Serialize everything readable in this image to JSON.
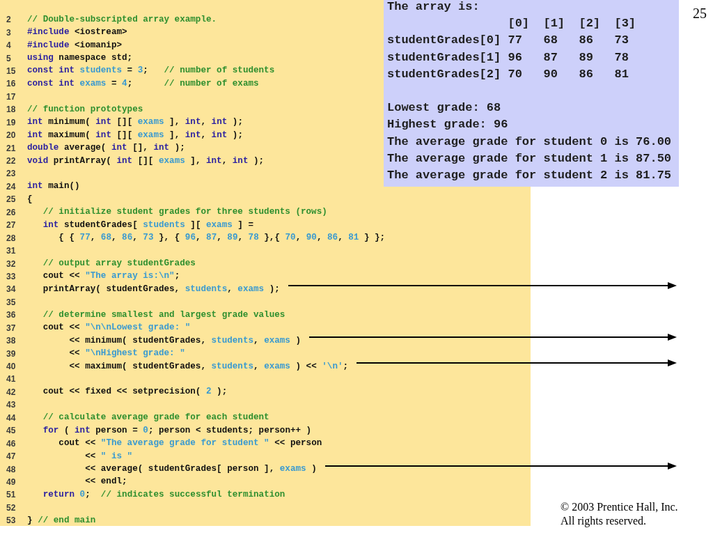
{
  "slide": {
    "number": "25"
  },
  "code": {
    "lines": [
      {
        "number": "2",
        "arrow": false,
        "tokens": [
          {
            "kind": "comment",
            "text": "// Double-subscripted array example."
          }
        ]
      },
      {
        "number": "3",
        "arrow": false,
        "tokens": [
          {
            "kind": "keyword",
            "text": "#include"
          },
          {
            "kind": "plain",
            "text": " <iostream>"
          }
        ]
      },
      {
        "number": "4",
        "arrow": false,
        "tokens": [
          {
            "kind": "keyword",
            "text": "#include"
          },
          {
            "kind": "plain",
            "text": " <iomanip>"
          }
        ]
      },
      {
        "number": "5",
        "arrow": false,
        "tokens": [
          {
            "kind": "keyword",
            "text": "using"
          },
          {
            "kind": "plain",
            "text": " namespace std;"
          }
        ]
      },
      {
        "number": "15",
        "arrow": false,
        "tokens": [
          {
            "kind": "keyword",
            "text": "const int "
          },
          {
            "kind": "literal",
            "text": "students"
          },
          {
            "kind": "plain",
            "text": " = "
          },
          {
            "kind": "literal",
            "text": "3"
          },
          {
            "kind": "plain",
            "text": ";   "
          },
          {
            "kind": "comment",
            "text": "// number of students"
          }
        ]
      },
      {
        "number": "16",
        "arrow": false,
        "tokens": [
          {
            "kind": "keyword",
            "text": "const int "
          },
          {
            "kind": "literal",
            "text": "exams"
          },
          {
            "kind": "plain",
            "text": " = "
          },
          {
            "kind": "literal",
            "text": "4"
          },
          {
            "kind": "plain",
            "text": ";      "
          },
          {
            "kind": "comment",
            "text": "// number of exams"
          }
        ]
      },
      {
        "number": "17",
        "arrow": false
      },
      {
        "number": "18",
        "arrow": false,
        "tokens": [
          {
            "kind": "comment",
            "text": "// function prototypes"
          }
        ]
      },
      {
        "number": "19",
        "arrow": false,
        "tokens": [
          {
            "kind": "keyword",
            "text": "int"
          },
          {
            "kind": "plain",
            "text": " minimum( "
          },
          {
            "kind": "keyword",
            "text": "int"
          },
          {
            "kind": "plain",
            "text": " [][ "
          },
          {
            "kind": "literal",
            "text": "exams"
          },
          {
            "kind": "plain",
            "text": " ], "
          },
          {
            "kind": "keyword",
            "text": "int"
          },
          {
            "kind": "plain",
            "text": ", "
          },
          {
            "kind": "keyword",
            "text": "int"
          },
          {
            "kind": "plain",
            "text": " );"
          }
        ]
      },
      {
        "number": "20",
        "arrow": false,
        "tokens": [
          {
            "kind": "keyword",
            "text": "int"
          },
          {
            "kind": "plain",
            "text": " maximum( "
          },
          {
            "kind": "keyword",
            "text": "int"
          },
          {
            "kind": "plain",
            "text": " [][ "
          },
          {
            "kind": "literal",
            "text": "exams"
          },
          {
            "kind": "plain",
            "text": " ], "
          },
          {
            "kind": "keyword",
            "text": "int"
          },
          {
            "kind": "plain",
            "text": ", "
          },
          {
            "kind": "keyword",
            "text": "int"
          },
          {
            "kind": "plain",
            "text": " );"
          }
        ]
      },
      {
        "number": "21",
        "arrow": false,
        "tokens": [
          {
            "kind": "keyword",
            "text": "double"
          },
          {
            "kind": "plain",
            "text": " average( "
          },
          {
            "kind": "keyword",
            "text": "int"
          },
          {
            "kind": "plain",
            "text": " [], "
          },
          {
            "kind": "keyword",
            "text": "int"
          },
          {
            "kind": "plain",
            "text": " );"
          }
        ]
      },
      {
        "number": "22",
        "arrow": false,
        "tokens": [
          {
            "kind": "keyword",
            "text": "void"
          },
          {
            "kind": "plain",
            "text": " printArray( "
          },
          {
            "kind": "keyword",
            "text": "int"
          },
          {
            "kind": "plain",
            "text": " [][ "
          },
          {
            "kind": "literal",
            "text": "exams"
          },
          {
            "kind": "plain",
            "text": " ], "
          },
          {
            "kind": "keyword",
            "text": "int"
          },
          {
            "kind": "plain",
            "text": ", "
          },
          {
            "kind": "keyword",
            "text": "int"
          },
          {
            "kind": "plain",
            "text": " );"
          }
        ]
      },
      {
        "number": "23",
        "arrow": false
      },
      {
        "number": "24",
        "arrow": false,
        "tokens": [
          {
            "kind": "keyword",
            "text": "int"
          },
          {
            "kind": "plain",
            "text": " main()"
          }
        ]
      },
      {
        "number": "25",
        "arrow": false,
        "tokens": [
          {
            "kind": "plain",
            "text": "{"
          }
        ]
      },
      {
        "number": "26",
        "arrow": false,
        "tokens": [
          {
            "kind": "comment",
            "text": "   // initialize student grades for three students (rows)"
          }
        ]
      },
      {
        "number": "27",
        "arrow": false,
        "tokens": [
          {
            "kind": "keyword",
            "text": "   int"
          },
          {
            "kind": "plain",
            "text": " studentGrades[ "
          },
          {
            "kind": "literal",
            "text": "students"
          },
          {
            "kind": "plain",
            "text": " ][ "
          },
          {
            "kind": "literal",
            "text": "exams"
          },
          {
            "kind": "plain",
            "text": " ] ="
          }
        ]
      },
      {
        "number": "28",
        "arrow": false,
        "tokens": [
          {
            "kind": "plain",
            "text": "      { { "
          },
          {
            "kind": "literal",
            "text": "77"
          },
          {
            "kind": "plain",
            "text": ", "
          },
          {
            "kind": "literal",
            "text": "68"
          },
          {
            "kind": "plain",
            "text": ", "
          },
          {
            "kind": "literal",
            "text": "86"
          },
          {
            "kind": "plain",
            "text": ", "
          },
          {
            "kind": "literal",
            "text": "73"
          },
          {
            "kind": "plain",
            "text": " }, { "
          },
          {
            "kind": "literal",
            "text": "96"
          },
          {
            "kind": "plain",
            "text": ", "
          },
          {
            "kind": "literal",
            "text": "87"
          },
          {
            "kind": "plain",
            "text": ", "
          },
          {
            "kind": "literal",
            "text": "89"
          },
          {
            "kind": "plain",
            "text": ", "
          },
          {
            "kind": "literal",
            "text": "78"
          },
          {
            "kind": "plain",
            "text": " },{ "
          },
          {
            "kind": "literal",
            "text": "70"
          },
          {
            "kind": "plain",
            "text": ", "
          },
          {
            "kind": "literal",
            "text": "90"
          },
          {
            "kind": "plain",
            "text": ", "
          },
          {
            "kind": "literal",
            "text": "86"
          },
          {
            "kind": "plain",
            "text": ", "
          },
          {
            "kind": "literal",
            "text": "81"
          },
          {
            "kind": "plain",
            "text": " } };"
          }
        ]
      },
      {
        "number": "31",
        "arrow": false
      },
      {
        "number": "32",
        "arrow": false,
        "tokens": [
          {
            "kind": "comment",
            "text": "   // output array studentGrades"
          }
        ]
      },
      {
        "number": "33",
        "arrow": false,
        "tokens": [
          {
            "kind": "plain",
            "text": "   cout << "
          },
          {
            "kind": "literal",
            "text": "\"The array is:\\n\""
          },
          {
            "kind": "plain",
            "text": ";"
          }
        ]
      },
      {
        "number": "34",
        "arrow": true,
        "tokens": [
          {
            "kind": "plain",
            "text": "   printArray( studentGrades, "
          },
          {
            "kind": "literal",
            "text": "students"
          },
          {
            "kind": "plain",
            "text": ", "
          },
          {
            "kind": "literal",
            "text": "exams"
          },
          {
            "kind": "plain",
            "text": " );"
          }
        ]
      },
      {
        "number": "35",
        "arrow": false
      },
      {
        "number": "36",
        "arrow": false,
        "tokens": [
          {
            "kind": "comment",
            "text": "   // determine smallest and largest grade values"
          }
        ]
      },
      {
        "number": "37",
        "arrow": false,
        "tokens": [
          {
            "kind": "plain",
            "text": "   cout << "
          },
          {
            "kind": "literal",
            "text": "\"\\n\\nLowest grade: \""
          }
        ]
      },
      {
        "number": "38",
        "arrow": true,
        "tokens": [
          {
            "kind": "plain",
            "text": "        << minimum( studentGrades, "
          },
          {
            "kind": "literal",
            "text": "students"
          },
          {
            "kind": "plain",
            "text": ", "
          },
          {
            "kind": "literal",
            "text": "exams"
          },
          {
            "kind": "plain",
            "text": " )"
          }
        ]
      },
      {
        "number": "39",
        "arrow": false,
        "tokens": [
          {
            "kind": "plain",
            "text": "        << "
          },
          {
            "kind": "literal",
            "text": "\"\\nHighest grade: \""
          }
        ]
      },
      {
        "number": "40",
        "arrow": true,
        "tokens": [
          {
            "kind": "plain",
            "text": "        << maximum( studentGrades, "
          },
          {
            "kind": "literal",
            "text": "students"
          },
          {
            "kind": "plain",
            "text": ", "
          },
          {
            "kind": "literal",
            "text": "exams"
          },
          {
            "kind": "plain",
            "text": " ) << "
          },
          {
            "kind": "literal",
            "text": "'\\n'"
          },
          {
            "kind": "plain",
            "text": ";"
          }
        ]
      },
      {
        "number": "41",
        "arrow": false
      },
      {
        "number": "42",
        "arrow": false,
        "tokens": [
          {
            "kind": "plain",
            "text": "   cout << fixed << setprecision( "
          },
          {
            "kind": "literal",
            "text": "2"
          },
          {
            "kind": "plain",
            "text": " );"
          }
        ]
      },
      {
        "number": "43",
        "arrow": false
      },
      {
        "number": "44",
        "arrow": false,
        "tokens": [
          {
            "kind": "comment",
            "text": "   // calculate average grade for each student"
          }
        ]
      },
      {
        "number": "45",
        "arrow": false,
        "tokens": [
          {
            "kind": "keyword",
            "text": "   for"
          },
          {
            "kind": "plain",
            "text": " ( "
          },
          {
            "kind": "keyword",
            "text": "int"
          },
          {
            "kind": "plain",
            "text": " person = "
          },
          {
            "kind": "literal",
            "text": "0"
          },
          {
            "kind": "plain",
            "text": "; person < students; person++ )"
          }
        ]
      },
      {
        "number": "46",
        "arrow": false,
        "tokens": [
          {
            "kind": "plain",
            "text": "      cout << "
          },
          {
            "kind": "literal",
            "text": "\"The average grade for student \""
          },
          {
            "kind": "plain",
            "text": " << person"
          }
        ]
      },
      {
        "number": "47",
        "arrow": false,
        "tokens": [
          {
            "kind": "plain",
            "text": "           << "
          },
          {
            "kind": "literal",
            "text": "\" is \""
          }
        ]
      },
      {
        "number": "48",
        "arrow": true,
        "tokens": [
          {
            "kind": "plain",
            "text": "           << average( studentGrades[ person ], "
          },
          {
            "kind": "literal",
            "text": "exams"
          },
          {
            "kind": "plain",
            "text": " )"
          }
        ]
      },
      {
        "number": "49",
        "arrow": false,
        "tokens": [
          {
            "kind": "plain",
            "text": "           << endl;"
          }
        ]
      },
      {
        "number": "51",
        "arrow": false,
        "tokens": [
          {
            "kind": "keyword",
            "text": "   return "
          },
          {
            "kind": "literal",
            "text": "0"
          },
          {
            "kind": "plain",
            "text": ";  "
          },
          {
            "kind": "comment",
            "text": "// indicates successful termination"
          }
        ]
      },
      {
        "number": "52",
        "arrow": false
      },
      {
        "number": "53",
        "arrow": false,
        "tokens": [
          {
            "kind": "plain",
            "text": "} "
          },
          {
            "kind": "comment",
            "text": "// end main"
          }
        ]
      }
    ]
  },
  "output": {
    "blocks": [
      [
        "The array is:",
        "                 [0]  [1]  [2]  [3]",
        "studentGrades[0] 77   68   86   73",
        "studentGrades[1] 96   87   89   78",
        "studentGrades[2] 70   90   86   81"
      ],
      [
        "Lowest grade: 68",
        "Highest grade: 96",
        "The average grade for student 0 is 76.00",
        "The average grade for student 1 is 87.50",
        "The average grade for student 2 is 81.75"
      ]
    ]
  },
  "footer": {
    "lines": [
      "© 2003 Prentice Hall, Inc.",
      "All rights reserved."
    ]
  }
}
